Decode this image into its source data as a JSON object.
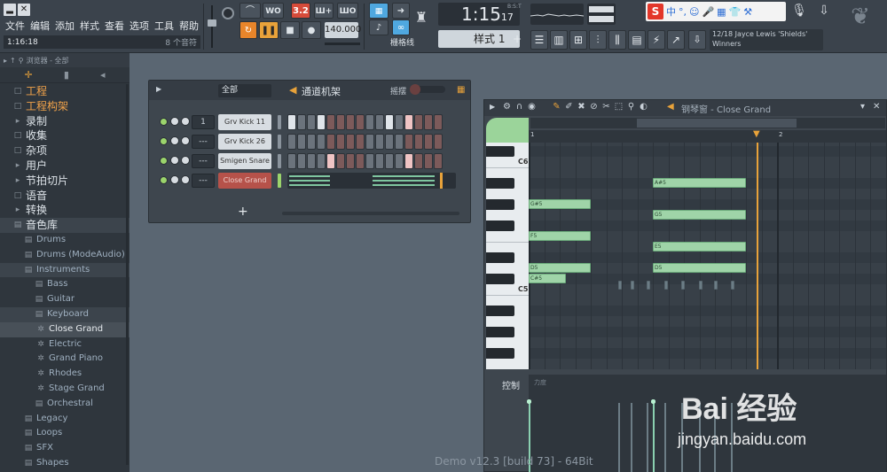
{
  "window": {
    "minimize": "▂",
    "close": "✕"
  },
  "menu": [
    "文件",
    "编辑",
    "添加",
    "样式",
    "查看",
    "选项",
    "工具",
    "帮助"
  ],
  "status": {
    "song_position": "1:16:18",
    "hint": "8 个音符"
  },
  "transport": {
    "metronome": "⌒",
    "wait": "WO",
    "countdown": "3.2",
    "step_edit": "Ш+",
    "loop_record": "ШО",
    "pattern_song_toggle": "↻",
    "play": "❚❚",
    "stop": "■",
    "record": "●",
    "tempo": "140.000"
  },
  "snap": {
    "label": "栅格线"
  },
  "time_display": {
    "main": "1:15",
    "sub": "17",
    "unit": "B:S:T"
  },
  "pattern": {
    "label": "样式 1",
    "add": "+"
  },
  "ime": {
    "logo": "S",
    "items": [
      "中",
      "°,",
      "☺",
      "🎤",
      "▦",
      "👕",
      "⚒"
    ]
  },
  "news": {
    "line1": "12/18  Jayce Lewis 'Shields'",
    "line2": "Winners"
  },
  "browser": {
    "header": "浏览器 - 全部",
    "items": [
      {
        "label": "工程",
        "level": "root",
        "icon": "□",
        "color": "orange"
      },
      {
        "label": "工程构架",
        "level": "root",
        "icon": "□",
        "color": "orange"
      },
      {
        "label": "录制",
        "level": "root",
        "icon": "▸"
      },
      {
        "label": "收集",
        "level": "root",
        "icon": "□"
      },
      {
        "label": "杂项",
        "level": "root",
        "icon": "□"
      },
      {
        "label": "用户",
        "level": "root",
        "icon": "▸"
      },
      {
        "label": "节拍切片",
        "level": "root",
        "icon": "▸"
      },
      {
        "label": "语音",
        "level": "root",
        "icon": "□"
      },
      {
        "label": "转换",
        "level": "root",
        "icon": "▸"
      },
      {
        "label": "音色库",
        "level": "root",
        "icon": "▤",
        "sel": true
      },
      {
        "label": "Drums",
        "level": "lvl1",
        "icon": "▤"
      },
      {
        "label": "Drums (ModeAudio)",
        "level": "lvl1",
        "icon": "▤"
      },
      {
        "label": "Instruments",
        "level": "lvl1",
        "icon": "▤",
        "sel": true
      },
      {
        "label": "Bass",
        "level": "lvl2",
        "icon": "▤"
      },
      {
        "label": "Guitar",
        "level": "lvl2",
        "icon": "▤"
      },
      {
        "label": "Keyboard",
        "level": "lvl2",
        "icon": "▤",
        "sel": true
      },
      {
        "label": "Close Grand",
        "level": "lvl3",
        "icon": "✲",
        "bright": true,
        "hl": true
      },
      {
        "label": "Electric",
        "level": "lvl3",
        "icon": "✲"
      },
      {
        "label": "Grand Piano",
        "level": "lvl3",
        "icon": "✲"
      },
      {
        "label": "Rhodes",
        "level": "lvl3",
        "icon": "✲"
      },
      {
        "label": "Stage Grand",
        "level": "lvl3",
        "icon": "✲"
      },
      {
        "label": "Orchestral",
        "level": "lvl2",
        "icon": "▤"
      },
      {
        "label": "Legacy",
        "level": "lvl1",
        "icon": "▤"
      },
      {
        "label": "Loops",
        "level": "lvl1",
        "icon": "▤"
      },
      {
        "label": "SFX",
        "level": "lvl1",
        "icon": "▤"
      },
      {
        "label": "Shapes",
        "level": "lvl1",
        "icon": "▤"
      },
      {
        "label": "Vocals",
        "level": "lvl1",
        "icon": "▤"
      }
    ]
  },
  "channel_rack": {
    "filter": "全部",
    "title": "通道机架",
    "swing_label": "摇摆",
    "add": "+",
    "channels": [
      {
        "name": "Grv Kick 11",
        "mixer": "1",
        "steps": [
          1,
          0,
          0,
          1,
          0,
          0,
          0,
          0,
          0,
          0,
          1,
          0,
          1,
          0,
          0,
          0
        ]
      },
      {
        "name": "Grv Kick 26",
        "mixer": "---",
        "steps": [
          0,
          0,
          0,
          0,
          0,
          0,
          0,
          0,
          0,
          0,
          0,
          0,
          0,
          0,
          0,
          0
        ]
      },
      {
        "name": "Smigen Snare 1",
        "mixer": "---",
        "steps": [
          0,
          0,
          0,
          0,
          1,
          0,
          0,
          0,
          0,
          0,
          0,
          0,
          1,
          0,
          0,
          0
        ]
      },
      {
        "name": "Close Grand",
        "mixer": "---",
        "selected": true
      }
    ]
  },
  "piano_roll": {
    "title": "钢琴窗 - Close Grand",
    "control_label": "控制",
    "ctrl_level_label": "力度",
    "ruler": [
      {
        "label": "1",
        "bar": 0
      },
      {
        "label": "2",
        "bar": 1
      }
    ],
    "key_labels": [
      {
        "label": "C6",
        "note": "C6"
      },
      {
        "label": "C5",
        "note": "C5"
      }
    ],
    "notes": [
      {
        "label": "A#5",
        "pitch": "A#5",
        "start": 1.0,
        "length": 0.75
      },
      {
        "label": "G#5",
        "pitch": "G#5",
        "start": 0.0,
        "length": 0.5
      },
      {
        "label": "G5",
        "pitch": "G5",
        "start": 1.0,
        "length": 0.75
      },
      {
        "label": "F5",
        "pitch": "F5",
        "start": 0.0,
        "length": 0.5
      },
      {
        "label": "E5",
        "pitch": "E5",
        "start": 1.0,
        "length": 0.75
      },
      {
        "label": "D5",
        "pitch": "D5",
        "start": 0.0,
        "length": 0.5
      },
      {
        "label": "D5",
        "pitch": "D5",
        "start": 1.0,
        "length": 0.75
      },
      {
        "label": "C#5",
        "pitch": "C#5",
        "start": 0.0,
        "length": 0.3
      }
    ],
    "playhead_bar": 1.4
  },
  "footer": {
    "version": "Demo v12.3 [build 73] - 64Bit"
  },
  "watermark": {
    "logo": "Bai 经验",
    "url": "jingyan.baidu.com"
  }
}
